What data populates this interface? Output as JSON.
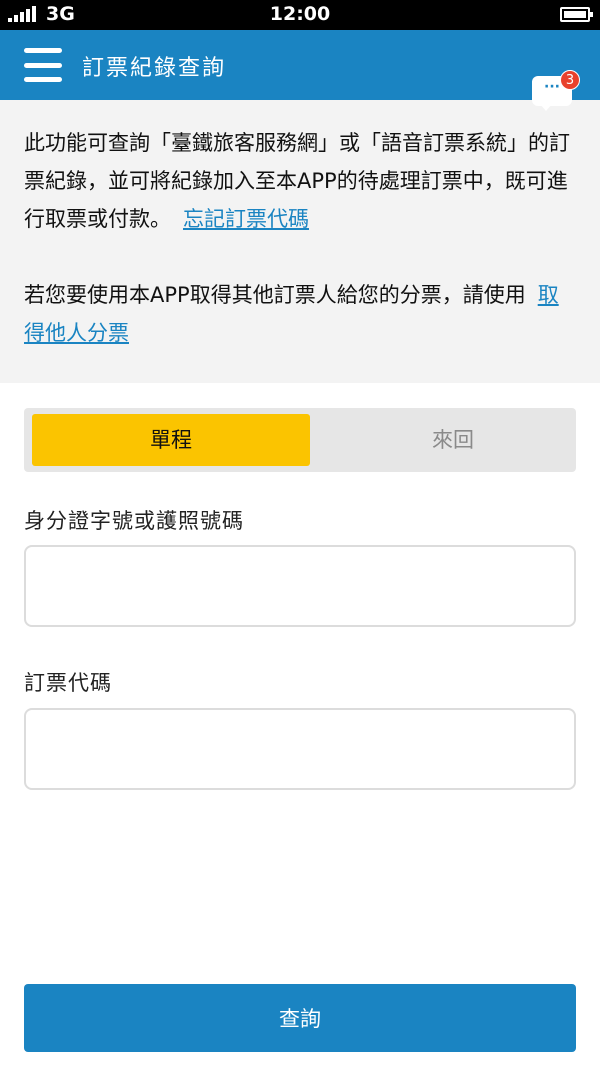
{
  "status_bar": {
    "network": "3G",
    "time": "12:00"
  },
  "navbar": {
    "title": "訂票紀錄查詢",
    "menu_icon": "hamburger-menu-icon",
    "message_icon": "chat-bubble-icon",
    "message_badge": "3",
    "message_glyph": "···"
  },
  "info": {
    "paragraph1": "此功能可查詢「臺鐵旅客服務網」或「語音訂票系統」的訂票紀錄，並可將紀錄加入至本APP的待處理訂票中，既可進行取票或付款。",
    "link1": "忘記訂票代碼",
    "paragraph2": "若您要使用本APP取得其他訂票人給您的分票，請使用",
    "link2": "取得他人分票"
  },
  "trip_type": {
    "options": [
      "單程",
      "來回"
    ],
    "selected": "單程"
  },
  "form": {
    "id_label": "身分證字號或護照號碼",
    "id_value": "",
    "code_label": "訂票代碼",
    "code_value": ""
  },
  "submit_label": "查詢",
  "colors": {
    "primary": "#1a84c2",
    "accent": "#fbc400",
    "badge": "#e8412c"
  }
}
